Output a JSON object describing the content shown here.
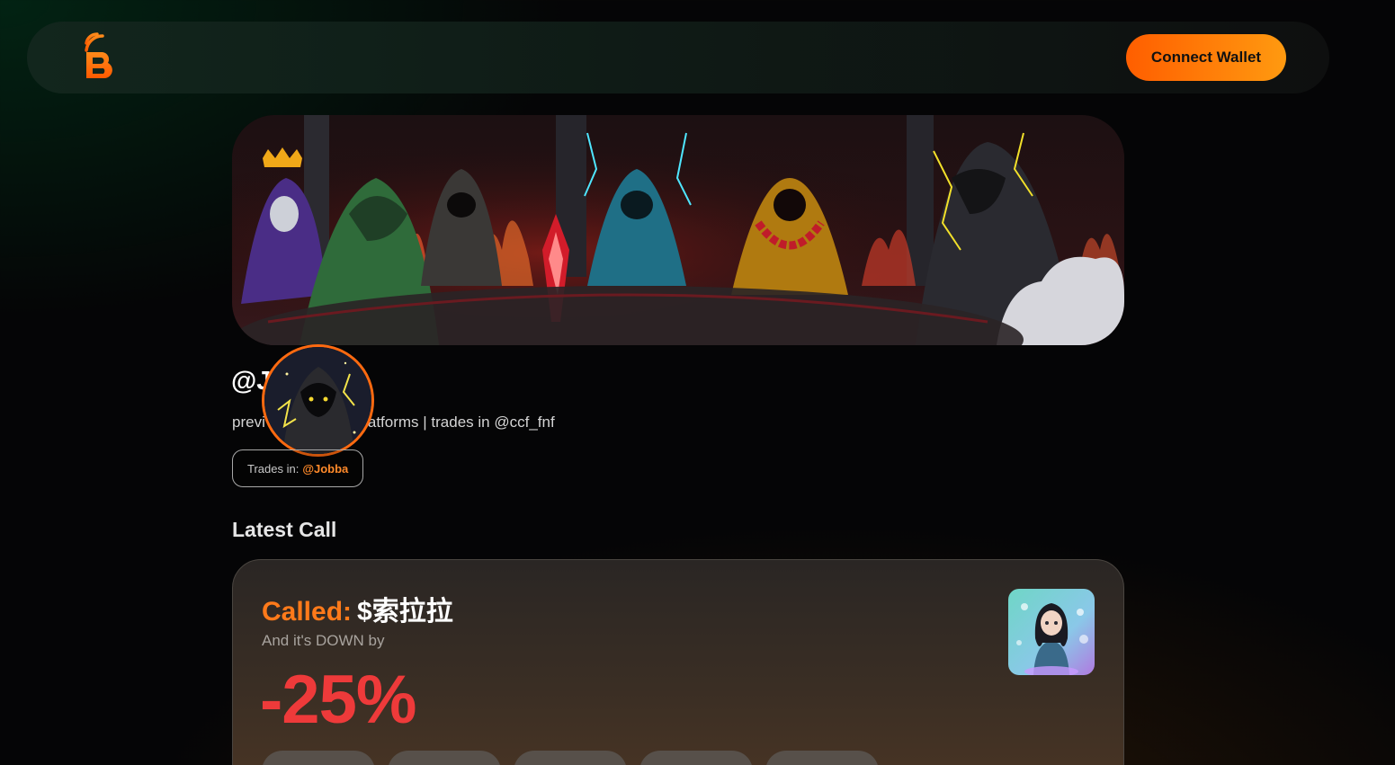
{
  "navbar": {
    "logo_icon": "brand-logo-icon",
    "connect_wallet_label": "Connect Wallet"
  },
  "banner": {
    "image": "hooded-figures-pixel-art-banner"
  },
  "profile": {
    "username": "@J",
    "bio": "previ                  dezz| Builds platforms | trades in @ccf_fnf",
    "avatar": "hooded-figure-avatar",
    "trades_in_label": "Trades in:",
    "trades_in_handle": "@Jobba"
  },
  "latest_call": {
    "section_title": "Latest Call",
    "called_label": "Called:",
    "token": "$索拉拉",
    "direction_text": "And it's DOWN by",
    "change": "-25%",
    "token_image": "anime-girl-token-image"
  },
  "colors": {
    "accent": "#ff6a10",
    "negative": "#ee3a3a"
  }
}
